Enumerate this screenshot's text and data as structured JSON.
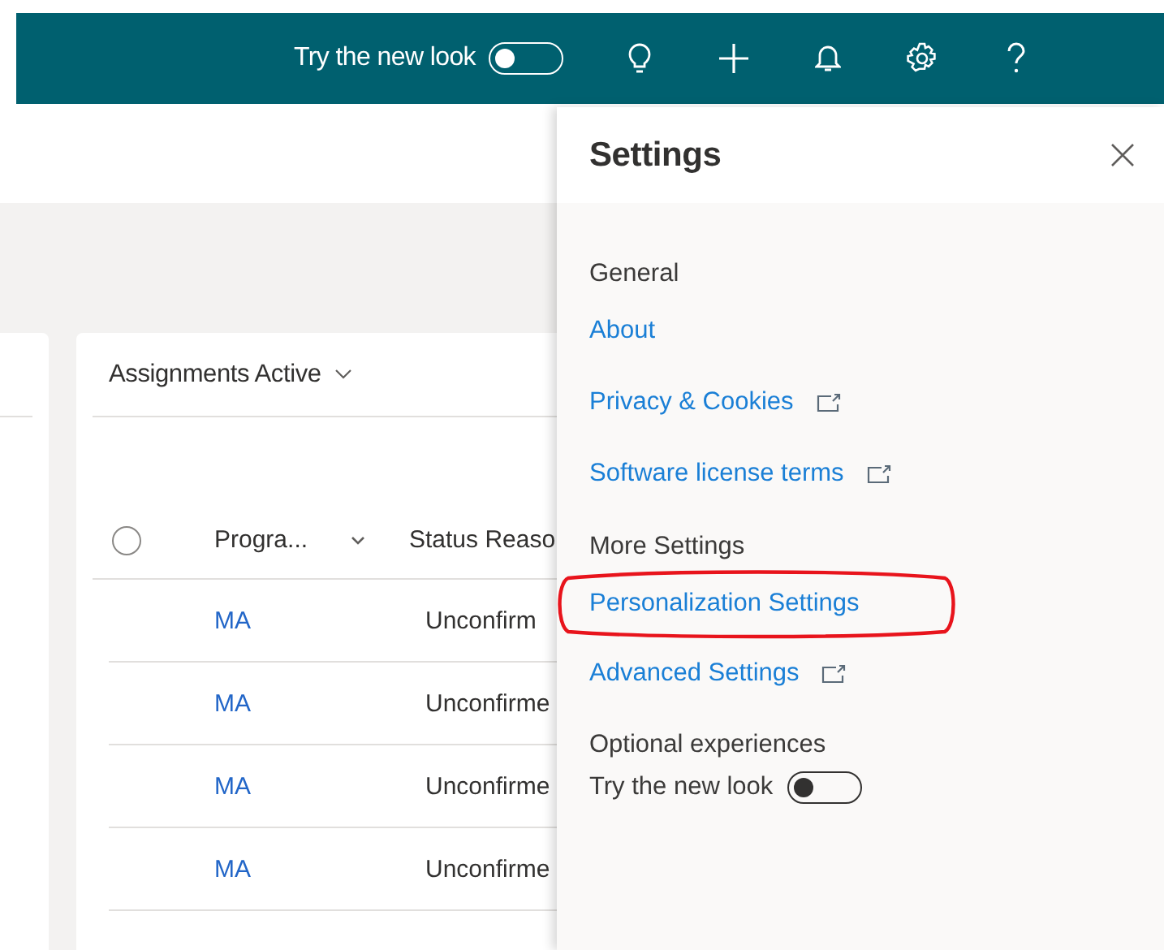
{
  "top_bar": {
    "new_look_label": "Try the new look",
    "new_look_toggle": {
      "on": false
    }
  },
  "view": {
    "title": "Assignments Active",
    "select_all": {
      "checked": false
    },
    "columns": [
      "Progra...",
      "Status Reaso"
    ],
    "rows": [
      {
        "program": "MA",
        "status": "Unconfirm"
      },
      {
        "program": "MA",
        "status": "Unconfirme"
      },
      {
        "program": "MA",
        "status": "Unconfirme"
      },
      {
        "program": "MA",
        "status": "Unconfirme"
      }
    ]
  },
  "settings_panel": {
    "title": "Settings",
    "sections": [
      {
        "heading": "General",
        "links": [
          {
            "label": "About",
            "external": false,
            "highlighted": false
          },
          {
            "label": "Privacy & Cookies",
            "external": true,
            "highlighted": false
          },
          {
            "label": "Software license terms",
            "external": true,
            "highlighted": false
          }
        ]
      },
      {
        "heading": "More Settings",
        "links": [
          {
            "label": "Personalization Settings",
            "external": false,
            "highlighted": true
          },
          {
            "label": "Advanced Settings",
            "external": true,
            "highlighted": false
          }
        ]
      }
    ],
    "optional": {
      "heading": "Optional experiences",
      "toggle_label": "Try the new look",
      "on": false
    }
  }
}
